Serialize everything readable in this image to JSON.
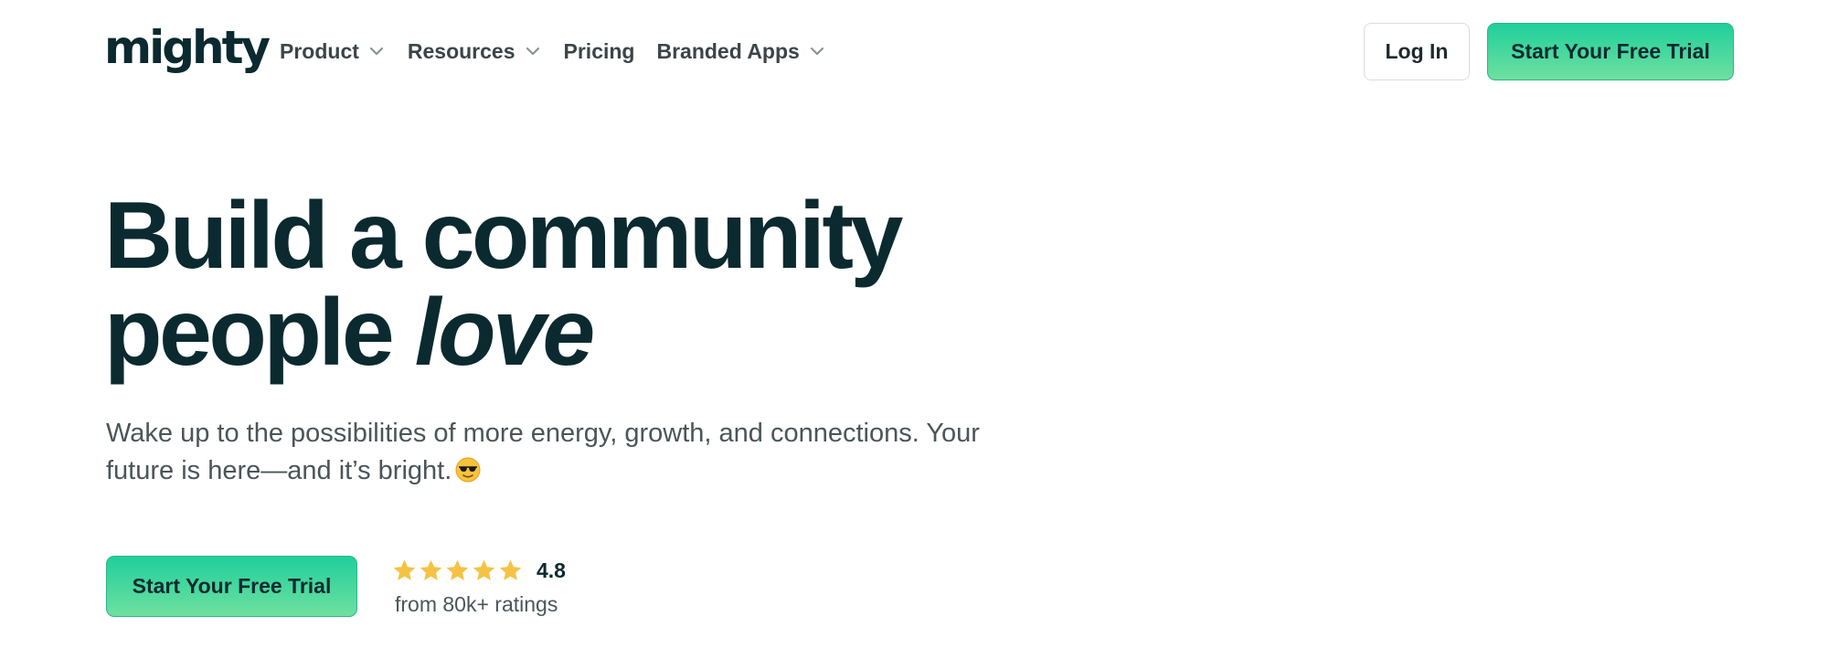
{
  "brand": {
    "logo_text": "mighty",
    "accent_color": "#1fcf9c",
    "text_color": "#0b2a30",
    "star_color": "#f6c244"
  },
  "nav": {
    "items": [
      {
        "label": "Product",
        "has_dropdown": true
      },
      {
        "label": "Resources",
        "has_dropdown": true
      },
      {
        "label": "Pricing",
        "has_dropdown": false
      },
      {
        "label": "Branded Apps",
        "has_dropdown": true
      }
    ],
    "login_label": "Log In",
    "trial_label": "Start Your Free Trial"
  },
  "hero": {
    "title_line1": "Build a community",
    "title_line2_plain": "people ",
    "title_line2_italic": "love",
    "subtitle": "Wake up to the possibilities of more energy, growth, and connections. Your future is here—and it’s bright.",
    "subtitle_emoji_icon": "sunglasses-face-icon",
    "cta_label": "Start Your Free Trial",
    "rating": {
      "stars": 5,
      "value": "4.8",
      "count_text": "from 80k+ ratings"
    }
  }
}
